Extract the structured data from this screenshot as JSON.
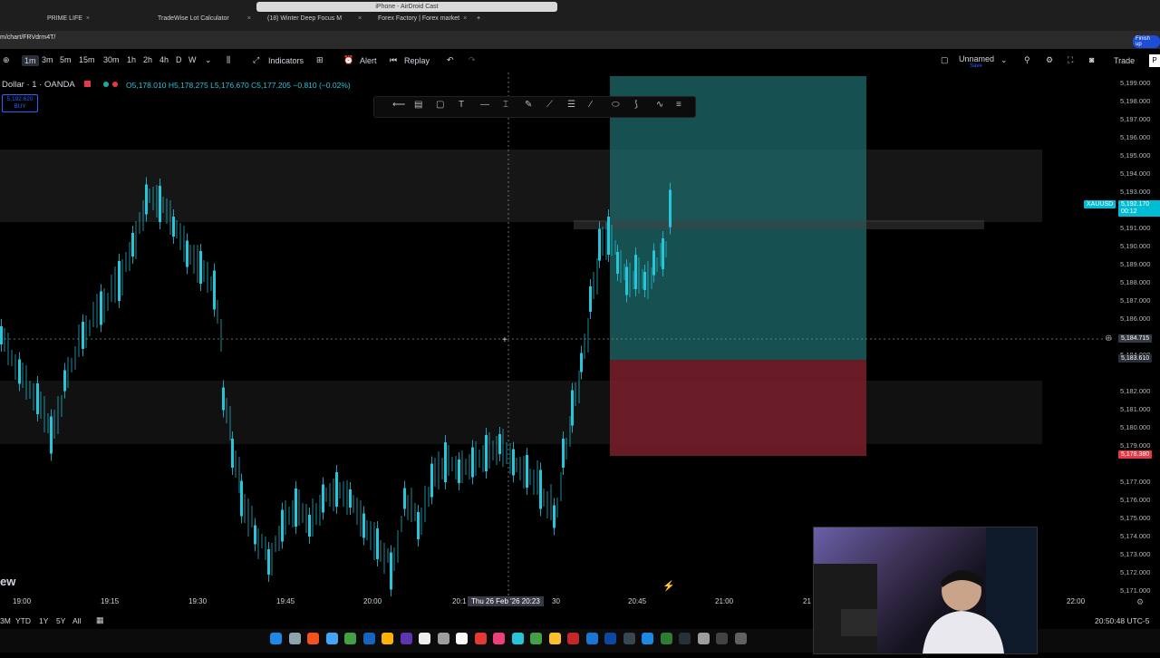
{
  "browser": {
    "tabs": [
      {
        "label": "PRIME LIFE"
      },
      {
        "label": "TradeWise Lot Calculator"
      },
      {
        "label": "(18) Winter Deep Focus M"
      },
      {
        "label": "Forex Factory | Forex market"
      }
    ],
    "airdroid_title": "iPhone - AirDroid Cast",
    "url": "m/chart/FRVdrm4T/",
    "finish_label": "Finish up"
  },
  "toolbar": {
    "timeframes": [
      "1m",
      "3m",
      "5m",
      "15m",
      "30m",
      "1h",
      "2h",
      "4h",
      "D",
      "W"
    ],
    "active_timeframe": "1m",
    "indicators_label": "Indicators",
    "alert_label": "Alert",
    "replay_label": "Replay",
    "layout_name": "Unnamed",
    "layout_sub": "Save",
    "trade_label": "Trade"
  },
  "legend": {
    "symbol": "Dollar · 1 · OANDA",
    "open": "O5,178.010",
    "high": "H5,178.275",
    "low": "L5,176.670",
    "close": "C5,177.205",
    "change": "−0.810 (−0.02%)",
    "buy_price": "5,192.620",
    "buy_label": "BUY"
  },
  "price_scale": {
    "labels": [
      "5,199.000",
      "5,198.000",
      "5,197.000",
      "5,196.000",
      "5,195.000",
      "5,194.000",
      "5,193.000",
      "5,191.000",
      "5,190.000",
      "5,189.000",
      "5,188.000",
      "5,187.000",
      "5,186.000",
      "5,184.000",
      "5,182.000",
      "5,181.000",
      "5,180.000",
      "5,179.000",
      "5,177.000",
      "5,176.000",
      "5,175.000",
      "5,174.000",
      "5,173.000",
      "5,172.000",
      "5,171.000"
    ],
    "current_symbol": "XAUUSD",
    "current_price": "5,192.170",
    "countdown": "00:12",
    "crosshair_price": "5,184.715",
    "entry_price": "5,183.610",
    "stop_price": "5,178.380"
  },
  "time_axis": {
    "labels": [
      "19:00",
      "19:15",
      "19:30",
      "19:45",
      "20:00",
      "20:1",
      "20:45",
      "21:00",
      "21",
      "22:00"
    ],
    "crosshair_label": "Thu 26 Feb '26  20:23",
    "crosshair_suffix": "30"
  },
  "bottom_bar": {
    "ranges": [
      "3M",
      "YTD",
      "1Y",
      "5Y",
      "All"
    ],
    "clock": "20:50:48 UTC-5"
  },
  "watermark": "ew",
  "colors": {
    "candle": "#26c6da",
    "profit_zone": "#1e6b6b",
    "loss_zone": "#7a1f2b",
    "price_label": "#00bcd4",
    "stop_label": "#e53945"
  }
}
